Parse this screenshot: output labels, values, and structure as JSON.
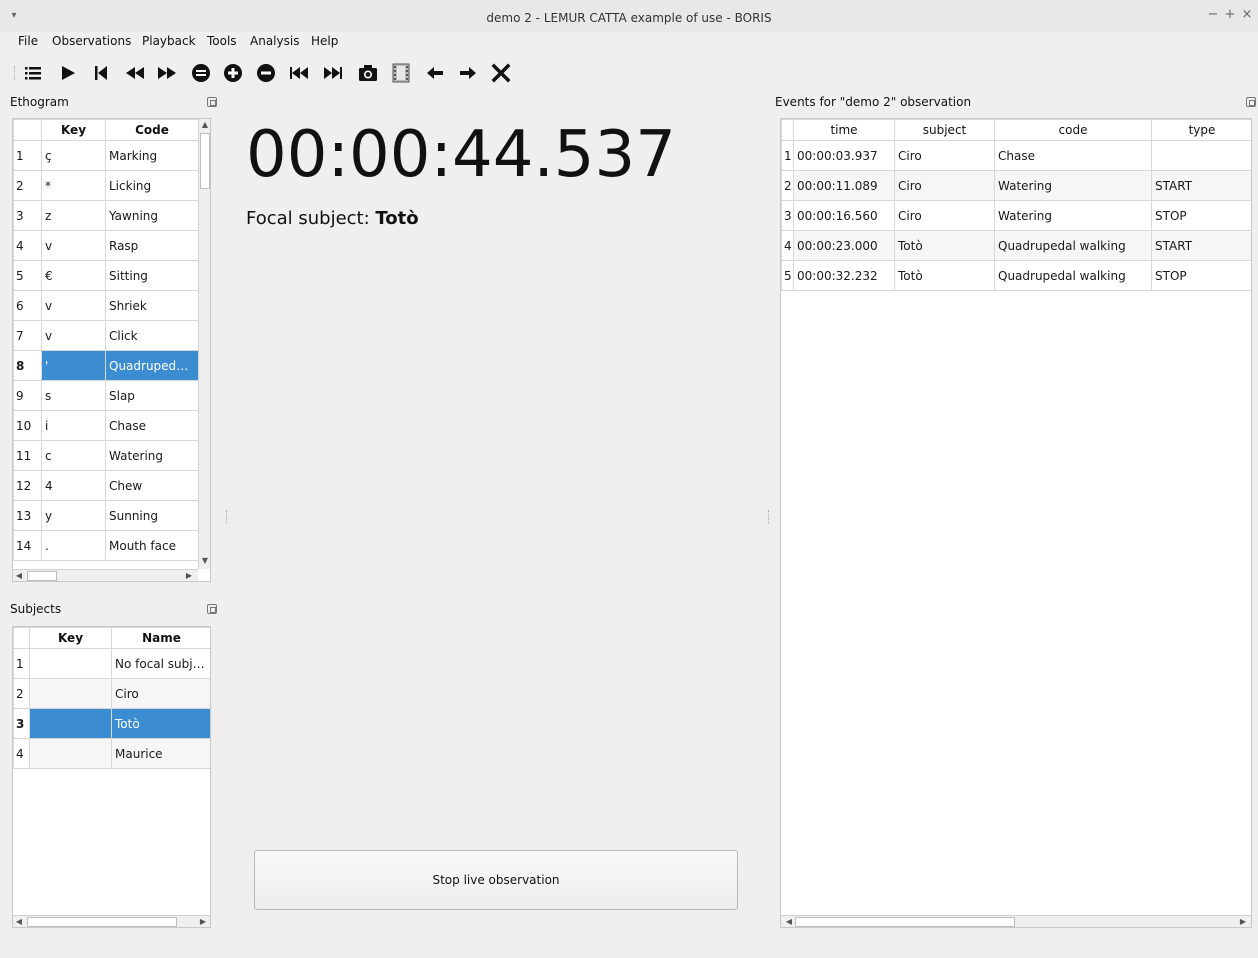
{
  "window": {
    "title": "demo 2 - LEMUR CATTA example of use - BORIS",
    "controls": [
      "−",
      "+",
      "×"
    ]
  },
  "menu": [
    "File",
    "Observations",
    "Playback",
    "Tools",
    "Analysis",
    "Help"
  ],
  "toolbar_icons": [
    "list-icon",
    "play-icon",
    "jump-to-start-icon",
    "rewind-icon",
    "fast-forward-icon",
    "equal-circle-icon",
    "plus-circle-icon",
    "minus-circle-icon",
    "previous-media-icon",
    "next-media-icon",
    "camera-icon",
    "film-frame-icon",
    "arrow-left-icon",
    "arrow-right-icon",
    "close-icon"
  ],
  "ethogram": {
    "title": "Ethogram",
    "headers": [
      "Key",
      "Code"
    ],
    "rows": [
      {
        "n": "1",
        "key": "ç",
        "code": "Marking"
      },
      {
        "n": "2",
        "key": "*",
        "code": "Licking"
      },
      {
        "n": "3",
        "key": "z",
        "code": "Yawning"
      },
      {
        "n": "4",
        "key": "v",
        "code": "Rasp"
      },
      {
        "n": "5",
        "key": "€",
        "code": "Sitting"
      },
      {
        "n": "6",
        "key": "v",
        "code": "Shriek"
      },
      {
        "n": "7",
        "key": "v",
        "code": "Click"
      },
      {
        "n": "8",
        "key": "'",
        "code": "Quadrupedal ..."
      },
      {
        "n": "9",
        "key": "s",
        "code": "Slap"
      },
      {
        "n": "10",
        "key": "i",
        "code": "Chase"
      },
      {
        "n": "11",
        "key": "c",
        "code": "Watering"
      },
      {
        "n": "12",
        "key": "4",
        "code": "Chew"
      },
      {
        "n": "13",
        "key": "y",
        "code": "Sunning"
      },
      {
        "n": "14",
        "key": ".",
        "code": "Mouth face"
      }
    ],
    "selected_row": 8
  },
  "subjects": {
    "title": "Subjects",
    "headers": [
      "Key",
      "Name"
    ],
    "rows": [
      {
        "n": "1",
        "key": "",
        "name": "No focal subject"
      },
      {
        "n": "2",
        "key": "",
        "name": "Ciro"
      },
      {
        "n": "3",
        "key": "",
        "name": "Totò"
      },
      {
        "n": "4",
        "key": "",
        "name": "Maurice"
      }
    ],
    "selected_row": 3
  },
  "live": {
    "timer": "00:00:44.537",
    "focal_label": "Focal subject:",
    "focal_name": "Totò",
    "stop_button": "Stop live observation"
  },
  "events": {
    "title": "Events for \"demo 2\" observation",
    "headers": [
      "time",
      "subject",
      "code",
      "type"
    ],
    "rows": [
      {
        "n": "1",
        "time": "00:00:03.937",
        "subject": "Ciro",
        "code": "Chase",
        "type": ""
      },
      {
        "n": "2",
        "time": "00:00:11.089",
        "subject": "Ciro",
        "code": "Watering",
        "type": "START"
      },
      {
        "n": "3",
        "time": "00:00:16.560",
        "subject": "Ciro",
        "code": "Watering",
        "type": "STOP"
      },
      {
        "n": "4",
        "time": "00:00:23.000",
        "subject": "Totò",
        "code": "Quadrupedal walking",
        "type": "START"
      },
      {
        "n": "5",
        "time": "00:00:32.232",
        "subject": "Totò",
        "code": "Quadrupedal walking",
        "type": "STOP"
      }
    ]
  },
  "colors": {
    "selection": "#3b8cd1",
    "background": "#efefef"
  }
}
